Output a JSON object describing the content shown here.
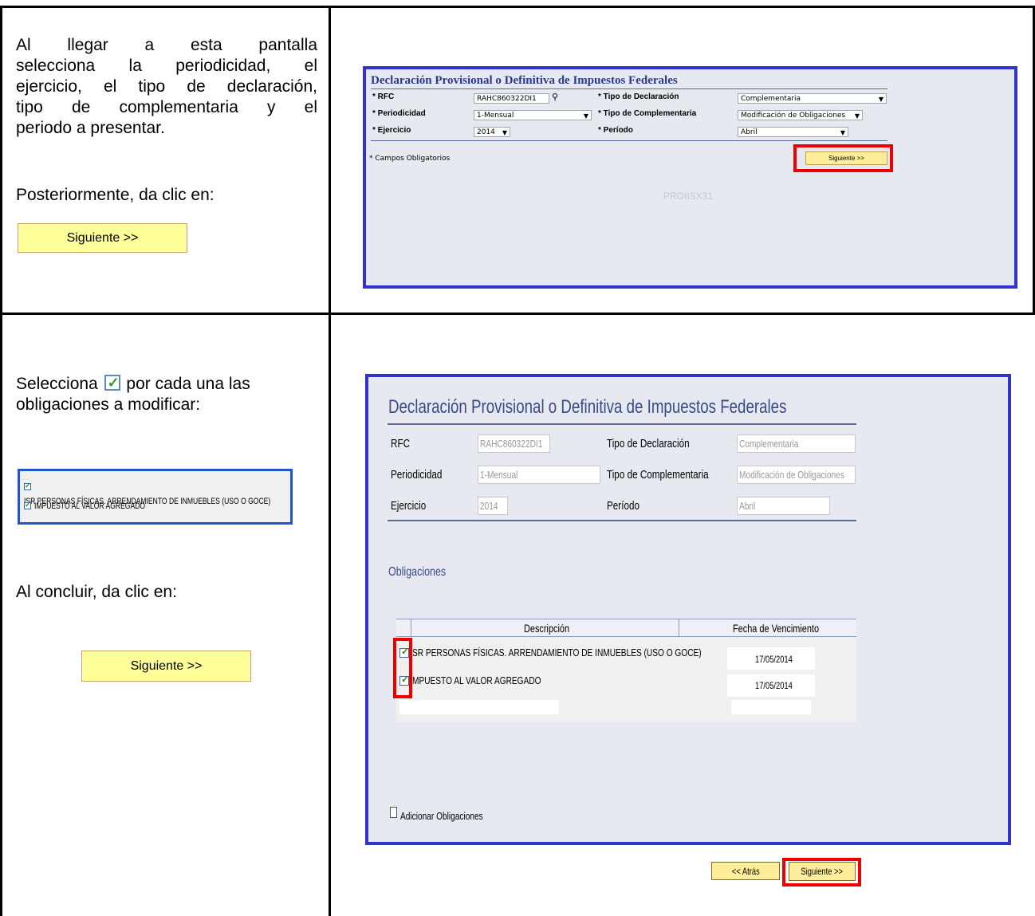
{
  "instructions": {
    "step1": {
      "paragraph_lines": [
        "Al llegar a esta pantalla",
        "selecciona la periodicidad, el",
        "ejercicio, el tipo de declaración,",
        "tipo de complementaria y el",
        "periodo a presentar."
      ],
      "then_text": "Posteriormente, da clic en:",
      "button_label": "Siguiente >>"
    },
    "step2": {
      "select_text_before": "Selecciona",
      "select_text_after": "por cada una las",
      "select_line2": "obligaciones a modificar:",
      "example_items": [
        "ISR PERSONAS FÍSICAS. ARRENDAMIENTO DE INMUEBLES (USO O GOCE)",
        "IMPUESTO AL VALOR AGREGADO"
      ],
      "conclude_text": "Al concluir, da clic en:",
      "button_label": "Siguiente >>"
    }
  },
  "screen1": {
    "title": "Declaración Provisional o Definitiva de Impuestos Federales",
    "labels": {
      "rfc": "* RFC",
      "periodicidad": "* Periodicidad",
      "ejercicio": "* Ejercicio",
      "tipo_declaracion": "* Tipo de Declaración",
      "tipo_complementaria": "* Tipo de Complementaria",
      "periodo": "* Período"
    },
    "values": {
      "rfc": "RAHC860322DI1",
      "periodicidad": "1-Mensual",
      "ejercicio": "2014",
      "tipo_declaracion": "Complementaria",
      "tipo_complementaria": "Modificación de Obligaciones",
      "periodo": "Abril"
    },
    "required_note": "* Campos Obligatorios",
    "next_button": "Siguiente >>",
    "watermark": "PROIISX31"
  },
  "screen2": {
    "title": "Declaración Provisional o Definitiva de Impuestos Federales",
    "labels": {
      "rfc": "RFC",
      "periodicidad": "Periodicidad",
      "ejercicio": "Ejercicio",
      "tipo_declaracion": "Tipo de Declaración",
      "tipo_complementaria": "Tipo de Complementaria",
      "periodo": "Período"
    },
    "values": {
      "rfc": "RAHC860322DI1",
      "periodicidad": "1-Mensual",
      "ejercicio": "2014",
      "tipo_declaracion": "Complementaria",
      "tipo_complementaria": "Modificación de Obligaciones",
      "periodo": "Abril"
    },
    "obligaciones_heading": "Obligaciones",
    "table": {
      "headers": [
        "Descripción",
        "Fecha de Vencimiento"
      ],
      "rows": [
        {
          "descripcion": "SR PERSONAS FÍSICAS. ARRENDAMIENTO DE INMUEBLES (USO O GOCE)",
          "fecha": "17/05/2014",
          "checked": true
        },
        {
          "descripcion": "MPUESTO AL VALOR AGREGADO",
          "fecha": "17/05/2014",
          "checked": true
        }
      ]
    },
    "add_obligaciones_label": "Adicionar Obligaciones",
    "back_button": "<< Atrás",
    "next_button": "Siguiente >>"
  }
}
